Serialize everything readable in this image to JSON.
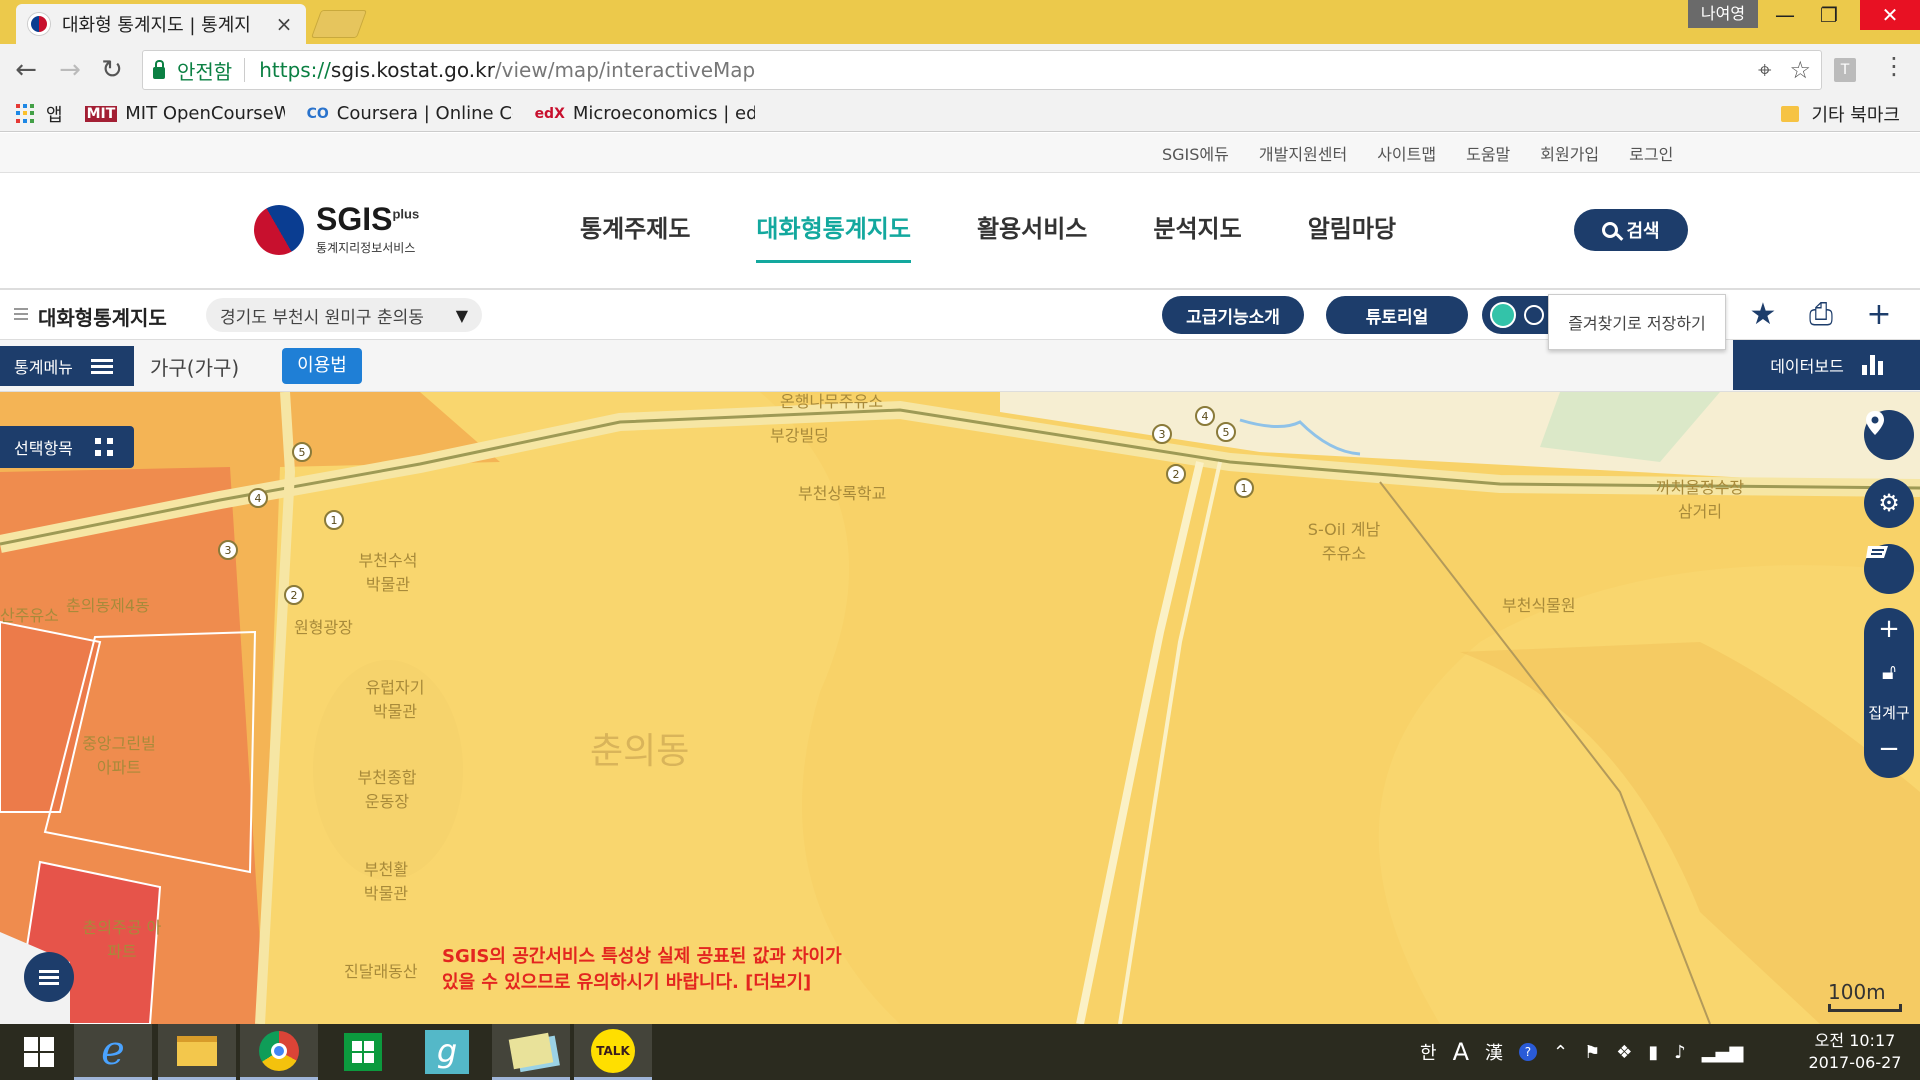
{
  "browser": {
    "tab_title": "대화형 통계지도 | 통계지",
    "tab_close": "×",
    "profile_name": "나여영",
    "window_controls": {
      "minimize": "—",
      "maximize": "❐",
      "close": "✕"
    },
    "nav": {
      "back": "←",
      "forward": "→",
      "reload": "↻"
    },
    "secure_label": "안전함",
    "url_scheme": "https://",
    "url_host": "sgis.kostat.go.kr",
    "url_path": "/view/map/interactiveMap",
    "extension_label": "T",
    "bookmarks": [
      {
        "icon": "apps-icon",
        "label": "앱"
      },
      {
        "icon": "mit-ocw-icon",
        "label": "MIT OpenCourseWar"
      },
      {
        "icon": "coursera-icon",
        "label": "Coursera | Online Co"
      },
      {
        "icon": "edx-icon",
        "label": "Microeconomics | ed"
      }
    ],
    "bookmark_icon_text": {
      "mit": "MIT",
      "coursera": "CO",
      "edx": "edX"
    },
    "other_bookmarks": "기타 북마크"
  },
  "site": {
    "util_links": [
      "SGIS에듀",
      "개발지원센터",
      "사이트맵",
      "도움말",
      "회원가입",
      "로그인"
    ],
    "logo_text": "SGIS",
    "logo_plus": "plus",
    "logo_sub": "통계지리정보서비스",
    "gnb": [
      {
        "label": "통계주제도",
        "active": false
      },
      {
        "label": "대화형통계지도",
        "active": true
      },
      {
        "label": "활용서비스",
        "active": false
      },
      {
        "label": "분석지도",
        "active": false
      },
      {
        "label": "알림마당",
        "active": false
      }
    ],
    "search_label": "검색"
  },
  "map_toolbar": {
    "title": "대화형통계지도",
    "location": "경기도 부천시 원미구 춘의동",
    "location_caret": "▼",
    "advanced_label": "고급기능소개",
    "tutorial_label": "튜토리얼",
    "favorite_tooltip": "즐겨찾기로 저장하기",
    "icons": {
      "star": "★",
      "print": "⎙",
      "plus": "+"
    }
  },
  "sub_bar": {
    "stat_menu": "통계메뉴",
    "stat_title": "가구(가구)",
    "usage_label": "이용법",
    "data_board": "데이터보드"
  },
  "map": {
    "select_items": "선택항목",
    "region_label": "춘의동",
    "labels": [
      "온행나무주유소",
      "부강빌딩",
      "부천상록학교",
      "부천수석 박물관",
      "원형광장",
      "유럽자기 박물관",
      "부천종합 운동장",
      "부천활 박물관",
      "진달래동산",
      "춘의동제4동",
      "중앙그린빌 아파트",
      "춘의주공 아파트",
      "S-Oil 계남주유소",
      "부천식물원",
      "까치울정수장 삼거리",
      "산주유소"
    ],
    "warning_line1": "SGIS의 공간서비스 특성상 실제 공표된 값과 차이가",
    "warning_line2": "있을 수 있으므로 유의하시기 바랍니다. [더보기]",
    "zoom_in": "+",
    "zoom_out": "−",
    "aggregate_label": "집계구",
    "scale_label": "100m",
    "fab_icons": {
      "settings": "⚙"
    },
    "route_numbers": [
      "5",
      "4",
      "3",
      "1",
      "2"
    ],
    "colors": {
      "light": "#f9d66e",
      "medium": "#f4b455",
      "orange": "#ef8c4e",
      "red": "#e6544a"
    }
  },
  "taskbar": {
    "tray": {
      "ime_kor": "한",
      "ime_a": "A",
      "ime_hanja": "漢",
      "help": "?",
      "up_arrow": "⌃"
    },
    "time": "오전 10:17",
    "date": "2017-06-27",
    "talk_label": "TALK"
  }
}
